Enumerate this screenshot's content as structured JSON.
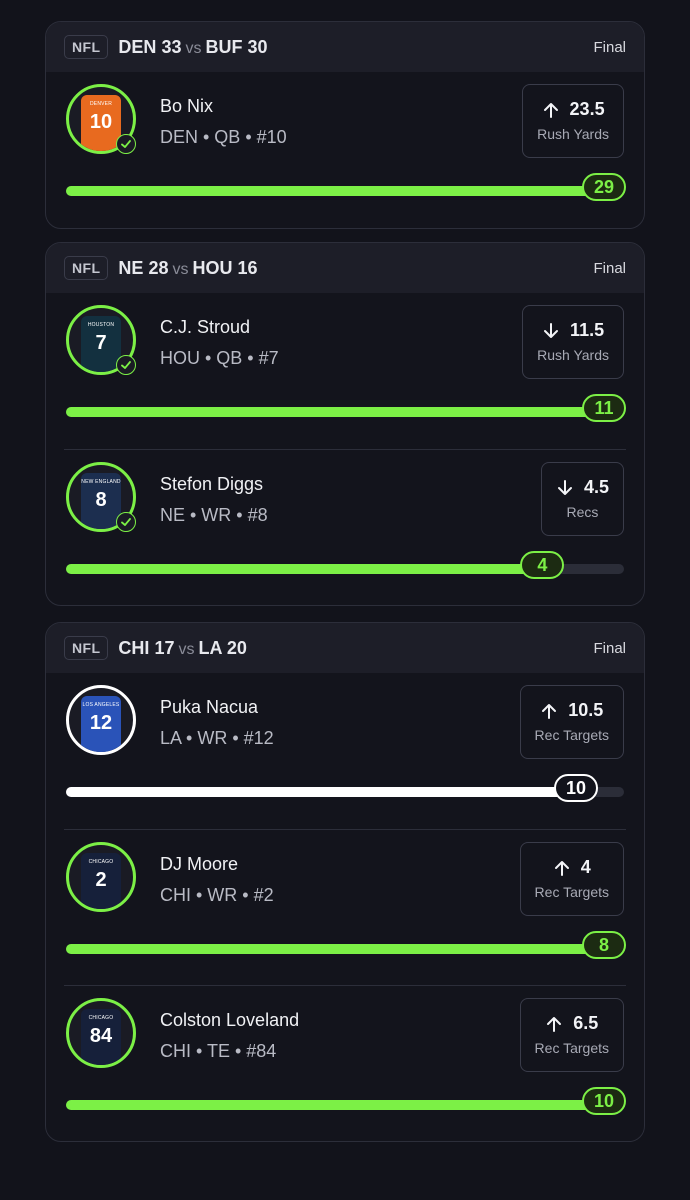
{
  "games": [
    {
      "league": "NFL",
      "away_team": "DEN",
      "away_score": "33",
      "vs": "vs",
      "home_team": "BUF",
      "home_score": "30",
      "status": "Final",
      "players": [
        {
          "name": "Bo Nix",
          "info": "DEN • QB • #10",
          "jersey_number": "10",
          "jersey_team": "DENVER",
          "jersey_color": "#e86a1f",
          "direction": "up",
          "line": "23.5",
          "stat": "Rush Yards",
          "result": "29",
          "progress": 1.0,
          "checked": true,
          "highlight": "green"
        }
      ]
    },
    {
      "league": "NFL",
      "away_team": "NE",
      "away_score": "28",
      "vs": "vs",
      "home_team": "HOU",
      "home_score": "16",
      "status": "Final",
      "players": [
        {
          "name": "C.J. Stroud",
          "info": "HOU • QB • #7",
          "jersey_number": "7",
          "jersey_team": "HOUSTON",
          "jersey_color": "#13303f",
          "direction": "down",
          "line": "11.5",
          "stat": "Rush Yards",
          "result": "11",
          "progress": 1.0,
          "checked": true,
          "highlight": "green"
        },
        {
          "name": "Stefon Diggs",
          "info": "NE • WR • #8",
          "jersey_number": "8",
          "jersey_team": "NEW ENGLAND",
          "jersey_color": "#1c2e4f",
          "direction": "down",
          "line": "4.5",
          "stat": "Recs",
          "result": "4",
          "progress": 0.89,
          "checked": true,
          "highlight": "green"
        }
      ]
    },
    {
      "league": "NFL",
      "away_team": "CHI",
      "away_score": "17",
      "vs": "vs",
      "home_team": "LA",
      "home_score": "20",
      "status": "Final",
      "players": [
        {
          "name": "Puka Nacua",
          "info": "LA • WR • #12",
          "jersey_number": "12",
          "jersey_team": "LOS ANGELES",
          "jersey_color": "#2a53b8",
          "direction": "up",
          "line": "10.5",
          "stat": "Rec Targets",
          "result": "10",
          "progress": 0.95,
          "checked": false,
          "highlight": "white"
        },
        {
          "name": "DJ Moore",
          "info": "CHI • WR • #2",
          "jersey_number": "2",
          "jersey_team": "CHICAGO",
          "jersey_color": "#16203a",
          "direction": "up",
          "line": "4",
          "stat": "Rec Targets",
          "result": "8",
          "progress": 1.0,
          "checked": false,
          "highlight": "green"
        },
        {
          "name": "Colston Loveland",
          "info": "CHI • TE • #84",
          "jersey_number": "84",
          "jersey_team": "CHICAGO",
          "jersey_color": "#16203a",
          "direction": "up",
          "line": "6.5",
          "stat": "Rec Targets",
          "result": "10",
          "progress": 1.0,
          "checked": false,
          "highlight": "green"
        }
      ]
    }
  ],
  "colors": {
    "accent": "#7cf046",
    "background": "#12131b",
    "card_header": "#1d1e28"
  }
}
